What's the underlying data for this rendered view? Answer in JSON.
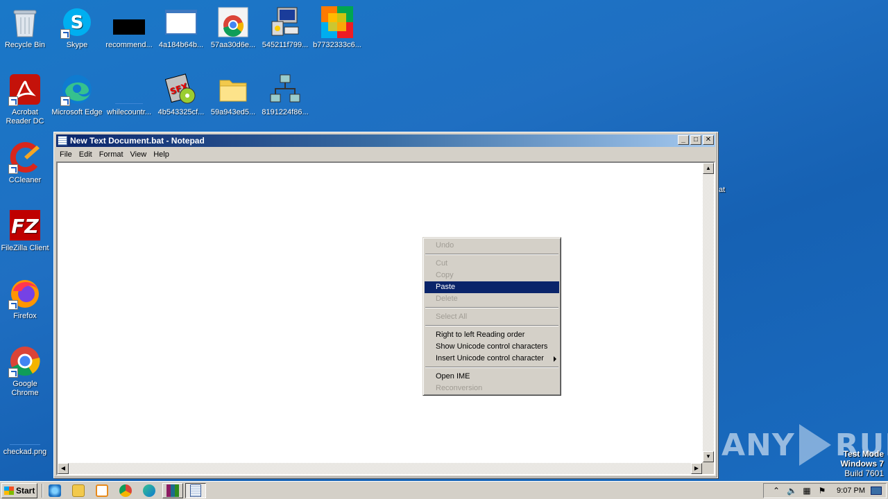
{
  "desktop": {
    "icons": [
      {
        "id": "recycle-bin",
        "label": "Recycle Bin"
      },
      {
        "id": "skype",
        "label": "Skype"
      },
      {
        "id": "recommend",
        "label": "recommend..."
      },
      {
        "id": "file-4a184b64b",
        "label": "4a184b64b..."
      },
      {
        "id": "file-57aa30d6e",
        "label": "57aa30d6e..."
      },
      {
        "id": "file-545211f799",
        "label": "545211f799..."
      },
      {
        "id": "file-b7732333c6",
        "label": "b7732333c6..."
      },
      {
        "id": "acrobat",
        "label": "Acrobat Reader DC"
      },
      {
        "id": "edge",
        "label": "Microsoft Edge"
      },
      {
        "id": "whilecountr",
        "label": "whilecountr..."
      },
      {
        "id": "file-4b543325cf",
        "label": "4b543325cf..."
      },
      {
        "id": "file-59a943ed5",
        "label": "59a943ed5..."
      },
      {
        "id": "file-8191224f86",
        "label": "8191224f86..."
      },
      {
        "id": "ccleaner",
        "label": "CCleaner"
      },
      {
        "id": "filezilla",
        "label": "FileZilla Client"
      },
      {
        "id": "firefox",
        "label": "Firefox"
      },
      {
        "id": "chrome",
        "label": "Google Chrome"
      },
      {
        "id": "checkad",
        "label": "checkad.png"
      }
    ],
    "partial_label": "at"
  },
  "notepad": {
    "title": "New Text Document.bat - Notepad",
    "menu": [
      "File",
      "Edit",
      "Format",
      "View",
      "Help"
    ],
    "controls": {
      "minimize": "_",
      "maximize": "□",
      "close": "✕"
    },
    "content": ""
  },
  "context_menu": {
    "items": [
      {
        "label": "Undo",
        "enabled": false
      },
      {
        "separator": true
      },
      {
        "label": "Cut",
        "enabled": false
      },
      {
        "label": "Copy",
        "enabled": false
      },
      {
        "label": "Paste",
        "enabled": true,
        "selected": true
      },
      {
        "label": "Delete",
        "enabled": false
      },
      {
        "separator": true
      },
      {
        "label": "Select All",
        "enabled": false
      },
      {
        "separator": true
      },
      {
        "label": "Right to left Reading order",
        "enabled": true
      },
      {
        "label": "Show Unicode control characters",
        "enabled": true
      },
      {
        "label": "Insert Unicode control character",
        "enabled": true,
        "submenu": true
      },
      {
        "separator": true
      },
      {
        "label": "Open IME",
        "enabled": true
      },
      {
        "label": "Reconversion",
        "enabled": false
      }
    ]
  },
  "watermark": {
    "left": "ANY",
    "right": "RUN"
  },
  "test_mode": {
    "line1": "Test Mode",
    "line2": "Windows 7",
    "line3": "Build 7601"
  },
  "taskbar": {
    "start_label": "Start",
    "clock": "9:07 PM"
  },
  "colors": {
    "desktop": "#1a6cc0",
    "titlebar_start": "#0a246a",
    "menu_highlight": "#0a246a",
    "chrome": "#d4d0c8"
  }
}
